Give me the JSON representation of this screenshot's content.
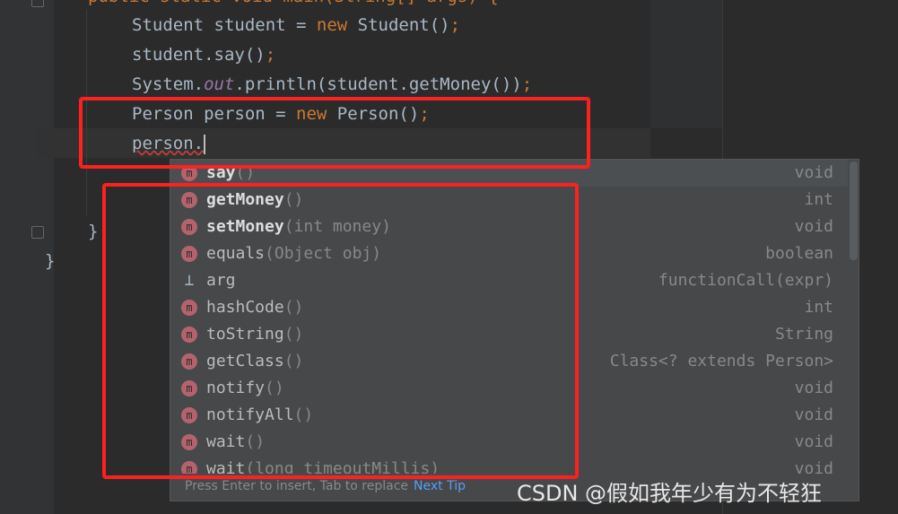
{
  "code": {
    "line0": "public static void main(String[] args) {",
    "line1": {
      "a": "Student student = ",
      "kw": "new",
      "b": " Student()",
      "semi": ";"
    },
    "line2": {
      "a": "student.say()",
      "semi": ";"
    },
    "line3": {
      "a": "System.",
      "field": "out",
      "b": ".println(student.getMoney())",
      "semi": ";"
    },
    "line4": {
      "a": "Person person = ",
      "kw": "new",
      "b": " Person()",
      "semi": ";"
    },
    "line5": "person.",
    "close1": "}",
    "close2": "}"
  },
  "completion": {
    "items": [
      {
        "name": "say",
        "params": "()",
        "type": "void",
        "icon": "method-icon",
        "bold": true
      },
      {
        "name": "getMoney",
        "params": "()",
        "type": "int",
        "icon": "method-icon",
        "bold": true
      },
      {
        "name": "setMoney",
        "params": "(int money)",
        "type": "void",
        "icon": "method-icon",
        "bold": true
      },
      {
        "name": "equals",
        "params": "(Object obj)",
        "type": "boolean",
        "icon": "method-icon"
      },
      {
        "name": "arg",
        "params": "",
        "type": "functionCall(expr)",
        "icon": "postfix-template-icon"
      },
      {
        "name": "hashCode",
        "params": "()",
        "type": "int",
        "icon": "method-icon"
      },
      {
        "name": "toString",
        "params": "()",
        "type": "String",
        "icon": "method-icon"
      },
      {
        "name": "getClass",
        "params": "()",
        "type": "Class<? extends Person>",
        "icon": "method-icon"
      },
      {
        "name": "notify",
        "params": "()",
        "type": "void",
        "icon": "method-icon"
      },
      {
        "name": "notifyAll",
        "params": "()",
        "type": "void",
        "icon": "method-icon"
      },
      {
        "name": "wait",
        "params": "()",
        "type": "void",
        "icon": "method-icon"
      },
      {
        "name": "wait",
        "params": "(long timeoutMillis)",
        "type": "void",
        "icon": "method-icon"
      }
    ],
    "method_glyph": "m",
    "footer": "Press Enter to insert, Tab to replace",
    "next_tip": "Next Tip"
  },
  "watermark": "CSDN @假如我年少有为不轻狂",
  "colors": {
    "annotation": "#ff2020",
    "keyword": "#cc7832",
    "link": "#589df6"
  }
}
